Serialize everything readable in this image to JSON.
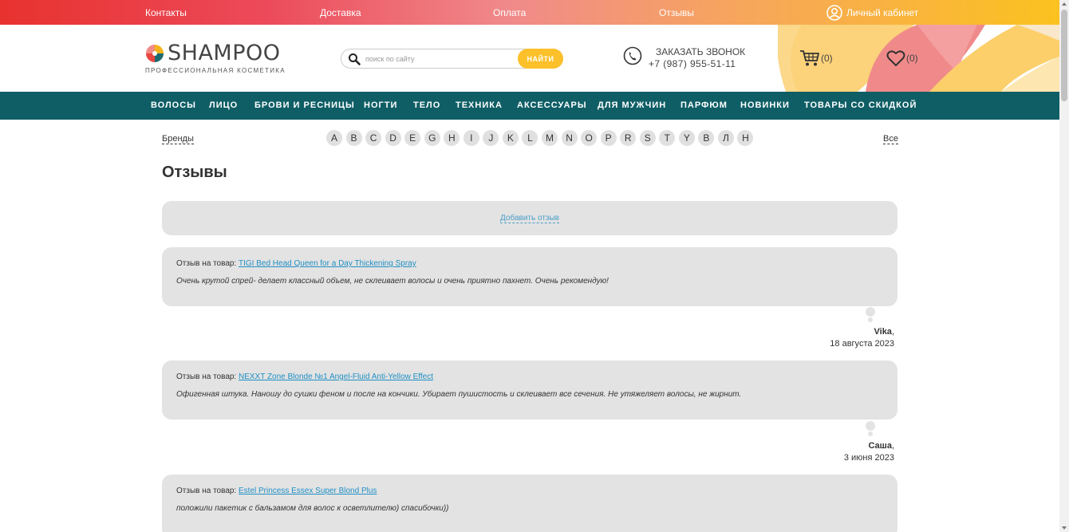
{
  "topbar": {
    "links": [
      "Контакты",
      "Доставка",
      "Оплата",
      "Отзывы"
    ],
    "account_label": "Личный кабинет"
  },
  "header": {
    "logo_text": "SHAMPOO",
    "logo_sub": "ПРОФЕССИОНАЛЬНАЯ КОСМЕТИКА",
    "search": {
      "placeholder": "поиск по сайту",
      "button_label": "НАЙТИ"
    },
    "callback": {
      "label": "ЗАКАЗАТЬ ЗВОНОК",
      "phone": "+7 (987) 955-51-11"
    },
    "cart_count": "(0)",
    "favorites_count": "(0)"
  },
  "nav": {
    "items": [
      "ВОЛОСЫ",
      "ЛИЦО",
      "БРОВИ И РЕСНИЦЫ",
      "НОГТИ",
      "ТЕЛО",
      "ТЕХНИКА",
      "АКСЕССУАРЫ",
      "ДЛЯ МУЖЧИН",
      "ПАРФЮМ",
      "НОВИНКИ",
      "ТОВАРЫ СО СКИДКОЙ"
    ]
  },
  "brands": {
    "label": "Бренды",
    "letters": [
      "A",
      "B",
      "C",
      "D",
      "E",
      "G",
      "H",
      "I",
      "J",
      "K",
      "L",
      "M",
      "N",
      "O",
      "P",
      "R",
      "S",
      "T",
      "Y",
      "B",
      "Л",
      "H"
    ],
    "all_label": "Все"
  },
  "page": {
    "title": "Отзывы",
    "add_review_label": "Добавить отзыв"
  },
  "reviews": [
    {
      "prefix": "Отзыв на товар:",
      "product": "TIGI Bed Head Queen for a Day Thickening Spray",
      "text": "Очень крутой спрей- делает классный объем, не склеивает волосы и очень приятно пахнет. Очень рекомендую!",
      "author": "Vika",
      "date": "18 августа 2023"
    },
    {
      "prefix": "Отзыв на товар:",
      "product": "NEXXT Zone Blonde №1 Angel-Fluid Anti-Yellow Effect",
      "text": "Офигенная штука. Наношу до сушки феном и после на кончики. Убирает пушистость и склеивает все сечения. Не утяжеляет волосы, не жирнит.",
      "author": "Саша",
      "date": "3 июня 2023"
    },
    {
      "prefix": "Отзыв на товар:",
      "product": "Estel Princess Essex Super Blond Plus",
      "text": "положили пакетик с бальзамом для волос к осветлителю) спасибочки))"
    }
  ],
  "colors": {
    "nav_bg": "#0f5e66",
    "accent_yellow": "#fcc02a",
    "link_blue": "#1f8fc4",
    "card_bg": "#e3e3e3"
  }
}
